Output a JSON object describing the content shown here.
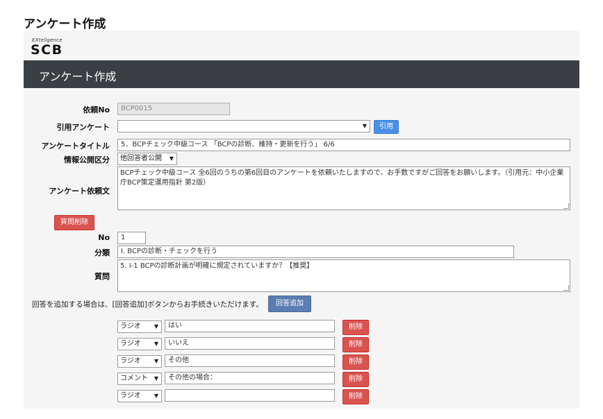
{
  "page": {
    "title": "アンケート作成"
  },
  "logo": {
    "small_text": "EXteligence",
    "main_text": "SCB"
  },
  "header": {
    "title": "アンケート作成"
  },
  "form": {
    "request_no": {
      "label": "依頼No",
      "value": "BCP0015"
    },
    "cited_survey": {
      "label": "引用アンケート",
      "value": "",
      "button": "引用"
    },
    "survey_title": {
      "label": "アンケートタイトル",
      "value": "5．BCPチェック中級コース 「BCPの診断、維持・更新を行う」 6/6"
    },
    "info_disclosure": {
      "label": "情報公開区分",
      "value": "他回答者公開"
    },
    "request_text": {
      "label": "アンケート依頼文",
      "value": "BCPチェック中級コース 全6回のうちの第6回目のアンケートを依頼いたしますので、お手数ですがご回答をお願いします。（引用元：中小企業庁BCP策定運用指針 第2版）"
    },
    "delete_question_button": "質問削除",
    "no": {
      "label": "No",
      "value": "1"
    },
    "category": {
      "label": "分類",
      "value": "Ⅰ. BCPの診断・チェックを行う"
    },
    "question": {
      "label": "質問",
      "value": "5. Ⅰ-1  BCPの診断計画が明確に規定されていますか？【推奨】"
    },
    "add_answer_hint": "回答を追加する場合は、[回答追加]ボタンからお手続きいただけます。",
    "add_answer_button": "回答追加",
    "answers": [
      {
        "type": "ラジオ",
        "text": "はい",
        "delete": "削除"
      },
      {
        "type": "ラジオ",
        "text": "いいえ",
        "delete": "削除"
      },
      {
        "type": "ラジオ",
        "text": "その他",
        "delete": "削除"
      },
      {
        "type": "コメント",
        "text": "その他の場合：",
        "delete": "削除"
      },
      {
        "type": "ラジオ",
        "text": "",
        "delete": "削除"
      }
    ]
  }
}
